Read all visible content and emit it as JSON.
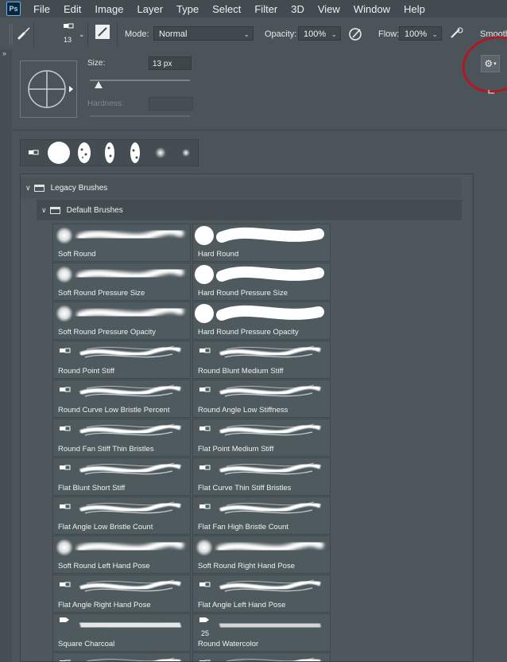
{
  "menubar": {
    "logo": "Ps",
    "items": [
      "File",
      "Edit",
      "Image",
      "Layer",
      "Type",
      "Select",
      "Filter",
      "3D",
      "View",
      "Window",
      "Help"
    ]
  },
  "options": {
    "brush_size": "13",
    "mode_label": "Mode:",
    "mode_value": "Normal",
    "opacity_label": "Opacity:",
    "opacity_value": "100%",
    "flow_label": "Flow:",
    "flow_value": "100%",
    "smoothing_label": "Smooth"
  },
  "brush_panel": {
    "size_label": "Size:",
    "size_value": "13 px",
    "hardness_label": "Hardness:",
    "folders": {
      "legacy": "Legacy Brushes",
      "default": "Default Brushes"
    },
    "brushes": [
      {
        "name": "Soft Round",
        "icon": "soft-round"
      },
      {
        "name": "Hard Round",
        "icon": "hard-round"
      },
      {
        "name": "Soft Round Pressure Size",
        "icon": "soft-round"
      },
      {
        "name": "Hard Round Pressure Size",
        "icon": "hard-round"
      },
      {
        "name": "Soft Round Pressure Opacity",
        "icon": "soft-round"
      },
      {
        "name": "Hard Round Pressure Opacity",
        "icon": "hard-round"
      },
      {
        "name": "Round Point Stiff",
        "icon": "bristle"
      },
      {
        "name": "Round Blunt Medium Stiff",
        "icon": "bristle"
      },
      {
        "name": "Round Curve Low Bristle Percent",
        "icon": "bristle"
      },
      {
        "name": "Round Angle Low Stiffness",
        "icon": "bristle"
      },
      {
        "name": "Round Fan Stiff Thin Bristles",
        "icon": "bristle"
      },
      {
        "name": "Flat Point Medium Stiff",
        "icon": "bristle"
      },
      {
        "name": "Flat Blunt Short Stiff",
        "icon": "bristle"
      },
      {
        "name": "Flat Curve Thin Stiff Bristles",
        "icon": "bristle"
      },
      {
        "name": "Flat Angle Low Bristle Count",
        "icon": "bristle"
      },
      {
        "name": "Flat Fan High Bristle Count",
        "icon": "bristle"
      },
      {
        "name": "Soft Round Left Hand Pose",
        "icon": "soft-round"
      },
      {
        "name": "Soft Round Right Hand Pose",
        "icon": "soft-round"
      },
      {
        "name": "Flat Angle Right Hand Pose",
        "icon": "bristle"
      },
      {
        "name": "Flat Angle Left Hand Pose",
        "icon": "bristle"
      },
      {
        "name": "Square Charcoal",
        "icon": "charcoal"
      },
      {
        "name": "Round Watercolor",
        "icon": "watercolor",
        "size": "25"
      }
    ]
  },
  "colors": {
    "annotation_red": "#b11825"
  }
}
